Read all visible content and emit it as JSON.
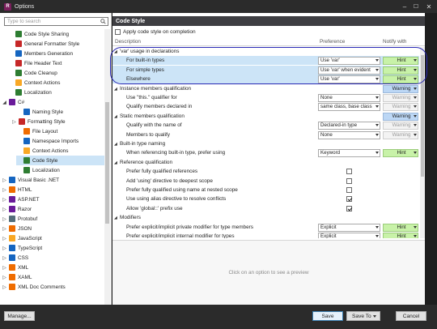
{
  "window": {
    "title": "Options"
  },
  "search": {
    "placeholder": "Type to search"
  },
  "tree": [
    {
      "label": "Code Style Sharing",
      "color": "#2e7d32"
    },
    {
      "label": "General Formatter Style",
      "color": "#c62828"
    },
    {
      "label": "Members Generation",
      "color": "#1565c0"
    },
    {
      "label": "File Header Text",
      "color": "#c62828"
    },
    {
      "label": "Code Cleanup",
      "color": "#2e7d32"
    },
    {
      "label": "Context Actions",
      "color": "#f9a825"
    },
    {
      "label": "Localization",
      "color": "#2e7d32"
    },
    {
      "label": "C#",
      "color": "#6a1b9a"
    },
    {
      "label": "Naming Style",
      "color": "#1565c0"
    },
    {
      "label": "Formatting Style",
      "color": "#c62828"
    },
    {
      "label": "File Layout",
      "color": "#ef6c00"
    },
    {
      "label": "Namespace Imports",
      "color": "#1565c0"
    },
    {
      "label": "Context Actions",
      "color": "#f9a825"
    },
    {
      "label": "Code Style",
      "color": "#2e7d32"
    },
    {
      "label": "Localization",
      "color": "#2e7d32"
    },
    {
      "label": "Visual Basic .NET",
      "color": "#1565c0"
    },
    {
      "label": "HTML",
      "color": "#ef6c00"
    },
    {
      "label": "ASP.NET",
      "color": "#6a1b9a"
    },
    {
      "label": "Razor",
      "color": "#6a1b9a"
    },
    {
      "label": "Protobuf",
      "color": "#546e7a"
    },
    {
      "label": "JSON",
      "color": "#ef6c00"
    },
    {
      "label": "JavaScript",
      "color": "#f9a825"
    },
    {
      "label": "TypeScript",
      "color": "#1565c0"
    },
    {
      "label": "CSS",
      "color": "#1565c0"
    },
    {
      "label": "XML",
      "color": "#ef6c00"
    },
    {
      "label": "XAML",
      "color": "#ef6c00"
    },
    {
      "label": "XML Doc Comments",
      "color": "#ef6c00"
    }
  ],
  "page": {
    "title": "Code Style",
    "apply_label": "Apply code style on completion",
    "columns": {
      "description": "Description",
      "preference": "Preference",
      "notify": "Notify with"
    },
    "rows": [
      {
        "kind": "section",
        "label": "'var' usage in declarations"
      },
      {
        "kind": "item",
        "label": "For built-in types",
        "pref": "Use 'var'",
        "notify": "Hint",
        "hl": true
      },
      {
        "kind": "item",
        "label": "For simple types",
        "pref": "Use 'var' when evident",
        "notify": "Hint",
        "hl": true
      },
      {
        "kind": "item",
        "label": "Elsewhere",
        "pref": "Use 'var'",
        "notify": "Hint",
        "hl": true
      },
      {
        "kind": "section",
        "label": "Instance members qualification",
        "notify": "Warning"
      },
      {
        "kind": "item",
        "label": "Use \"this.\" qualifier for",
        "pref": "None",
        "notify": "Warning"
      },
      {
        "kind": "item",
        "label": "Qualify members declared in",
        "pref": "same class, base class",
        "notify": "Warning"
      },
      {
        "kind": "section",
        "label": "Static members qualification",
        "notify": "Warning"
      },
      {
        "kind": "item",
        "label": "Qualify with the name of",
        "pref": "Declared-in type",
        "notify": "Warning"
      },
      {
        "kind": "item",
        "label": "Members to qualify",
        "pref": "None",
        "notify": "Warning"
      },
      {
        "kind": "section",
        "label": "Built-in type naming"
      },
      {
        "kind": "item",
        "label": "When referencing built-in type, prefer using",
        "pref": "Keyword",
        "notify": "Hint"
      },
      {
        "kind": "section",
        "label": "Reference qualification"
      },
      {
        "kind": "check",
        "label": "Prefer fully qualified references",
        "checked": false
      },
      {
        "kind": "check",
        "label": "Add 'using' directive to deepest scope",
        "checked": false
      },
      {
        "kind": "check",
        "label": "Prefer fully qualified using name at nested scope",
        "checked": false
      },
      {
        "kind": "check",
        "label": "Use using alias directive to resolve conflicts",
        "checked": true
      },
      {
        "kind": "check",
        "label": "Allow 'global::' prefix use",
        "checked": true
      },
      {
        "kind": "section",
        "label": "Modifiers"
      },
      {
        "kind": "item",
        "label": "Prefer explicit/implicit private modifier for type members",
        "pref": "Explicit",
        "notify": "Hint"
      },
      {
        "kind": "item",
        "label": "Prefer explicit/implicit internal modifier for types",
        "pref": "Explicit",
        "notify": "Hint"
      }
    ],
    "preview_text": "Click on an option to see a preview"
  },
  "buttons": {
    "manage": "Manage...",
    "save": "Save",
    "save_to": "Save To",
    "cancel": "Cancel"
  }
}
